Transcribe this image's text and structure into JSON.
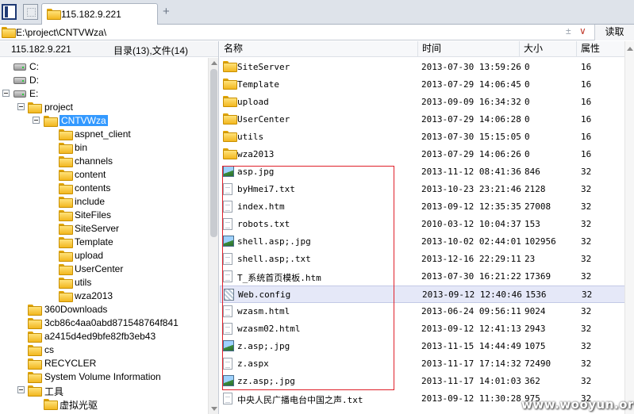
{
  "tabbar": {
    "tab_title": "115.182.9.221",
    "add_symbol": "+"
  },
  "addressbar": {
    "path": "E:\\project\\CNTVWza\\",
    "extra_symbol": "±",
    "dropdown_symbol": "∨",
    "read_label": "读取"
  },
  "left": {
    "ip": "115.182.9.221",
    "count": "目录(13),文件(14)",
    "tree": [
      {
        "label": "C:",
        "icon": "drive-icon",
        "indent": 0,
        "toggle": false
      },
      {
        "label": "D:",
        "icon": "drive-icon",
        "indent": 0,
        "toggle": false
      },
      {
        "label": "E:",
        "icon": "drive-icon",
        "indent": 0,
        "toggle": true
      },
      {
        "label": "project",
        "icon": "folder-icon",
        "indent": 1,
        "toggle": true
      },
      {
        "label": "CNTVWza",
        "icon": "folder-icon",
        "indent": 2,
        "toggle": true,
        "selected": true
      },
      {
        "label": "aspnet_client",
        "icon": "folder-icon",
        "indent": 3,
        "toggle": false
      },
      {
        "label": "bin",
        "icon": "folder-icon",
        "indent": 3,
        "toggle": false
      },
      {
        "label": "channels",
        "icon": "folder-icon",
        "indent": 3,
        "toggle": false
      },
      {
        "label": "content",
        "icon": "folder-icon",
        "indent": 3,
        "toggle": false
      },
      {
        "label": "contents",
        "icon": "folder-icon",
        "indent": 3,
        "toggle": false
      },
      {
        "label": "include",
        "icon": "folder-icon",
        "indent": 3,
        "toggle": false
      },
      {
        "label": "SiteFiles",
        "icon": "folder-icon",
        "indent": 3,
        "toggle": false
      },
      {
        "label": "SiteServer",
        "icon": "folder-icon",
        "indent": 3,
        "toggle": false
      },
      {
        "label": "Template",
        "icon": "folder-icon",
        "indent": 3,
        "toggle": false
      },
      {
        "label": "upload",
        "icon": "folder-icon",
        "indent": 3,
        "toggle": false
      },
      {
        "label": "UserCenter",
        "icon": "folder-icon",
        "indent": 3,
        "toggle": false
      },
      {
        "label": "utils",
        "icon": "folder-icon",
        "indent": 3,
        "toggle": false
      },
      {
        "label": "wza2013",
        "icon": "folder-icon",
        "indent": 3,
        "toggle": false
      },
      {
        "label": "360Downloads",
        "icon": "folder-icon",
        "indent": 1,
        "toggle": false
      },
      {
        "label": "3cb86c4aa0abd871548764f841",
        "icon": "folder-icon",
        "indent": 1,
        "toggle": false
      },
      {
        "label": "a2415d4ed9bfe82fb3eb43",
        "icon": "folder-icon",
        "indent": 1,
        "toggle": false
      },
      {
        "label": "cs",
        "icon": "folder-icon",
        "indent": 1,
        "toggle": false
      },
      {
        "label": "RECYCLER",
        "icon": "folder-icon",
        "indent": 1,
        "toggle": false
      },
      {
        "label": "System Volume Information",
        "icon": "folder-icon",
        "indent": 1,
        "toggle": false
      },
      {
        "label": "工具",
        "icon": "folder-icon",
        "indent": 1,
        "toggle": true
      },
      {
        "label": "虚拟光驱",
        "icon": "folder-icon",
        "indent": 2,
        "toggle": false
      }
    ]
  },
  "right": {
    "columns": {
      "name": "名称",
      "time": "时间",
      "size": "大小",
      "attr": "属性"
    },
    "rows": [
      {
        "name": "SiteServer",
        "time": "2013-07-30 13:59:26",
        "size": "0",
        "attr": "16",
        "icon": "folder-icon"
      },
      {
        "name": "Template",
        "time": "2013-07-29 14:06:45",
        "size": "0",
        "attr": "16",
        "icon": "folder-icon"
      },
      {
        "name": "upload",
        "time": "2013-09-09 16:34:32",
        "size": "0",
        "attr": "16",
        "icon": "folder-icon"
      },
      {
        "name": "UserCenter",
        "time": "2013-07-29 14:06:28",
        "size": "0",
        "attr": "16",
        "icon": "folder-icon"
      },
      {
        "name": "utils",
        "time": "2013-07-30 15:15:05",
        "size": "0",
        "attr": "16",
        "icon": "folder-icon"
      },
      {
        "name": "wza2013",
        "time": "2013-07-29 14:06:26",
        "size": "0",
        "attr": "16",
        "icon": "folder-icon"
      },
      {
        "name": "asp.jpg",
        "time": "2013-11-12 08:41:36",
        "size": "846",
        "attr": "32",
        "icon": "image-file-icon"
      },
      {
        "name": "byHmei7.txt",
        "time": "2013-10-23 23:21:46",
        "size": "2128",
        "attr": "32",
        "icon": "text-file-icon"
      },
      {
        "name": "index.htm",
        "time": "2013-09-12 12:35:35",
        "size": "27008",
        "attr": "32",
        "icon": "text-file-icon"
      },
      {
        "name": "robots.txt",
        "time": "2010-03-12 10:04:37",
        "size": "153",
        "attr": "32",
        "icon": "text-file-icon"
      },
      {
        "name": "shell.asp;.jpg",
        "time": "2013-10-02 02:44:01",
        "size": "102956",
        "attr": "32",
        "icon": "image-file-icon"
      },
      {
        "name": "shell.asp;.txt",
        "time": "2013-12-16 22:29:11",
        "size": "23",
        "attr": "32",
        "icon": "text-file-icon"
      },
      {
        "name": "T_系统首页模板.htm",
        "time": "2013-07-30 16:21:22",
        "size": "17369",
        "attr": "32",
        "icon": "text-file-icon"
      },
      {
        "name": "Web.config",
        "time": "2013-09-12 12:40:46",
        "size": "1536",
        "attr": "32",
        "icon": "config-file-icon",
        "highlight": true
      },
      {
        "name": "wzasm.html",
        "time": "2013-06-24 09:56:11",
        "size": "9024",
        "attr": "32",
        "icon": "text-file-icon"
      },
      {
        "name": "wzasm02.html",
        "time": "2013-09-12 12:41:13",
        "size": "2943",
        "attr": "32",
        "icon": "text-file-icon"
      },
      {
        "name": "z.asp;.jpg",
        "time": "2013-11-15 14:44:49",
        "size": "1075",
        "attr": "32",
        "icon": "image-file-icon"
      },
      {
        "name": "z.aspx",
        "time": "2013-11-17 17:14:32",
        "size": "72490",
        "attr": "32",
        "icon": "text-file-icon"
      },
      {
        "name": "zz.asp;.jpg",
        "time": "2013-11-17 14:01:03",
        "size": "362",
        "attr": "32",
        "icon": "image-file-icon"
      },
      {
        "name": "中央人民广播电台中国之声.txt",
        "time": "2013-09-12 11:30:28",
        "size": "975",
        "attr": "32",
        "icon": "text-file-icon"
      }
    ]
  },
  "accent_colors": {
    "selection": "#3399ff",
    "highlight_row": "#e5e8f8",
    "annotation_box": "#e0202a"
  },
  "watermark": "www.wooyun.org"
}
